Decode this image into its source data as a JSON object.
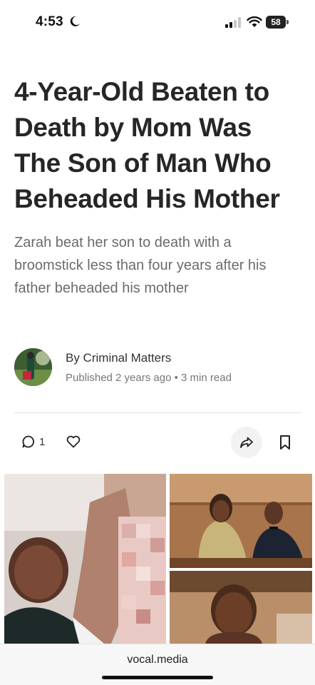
{
  "status_bar": {
    "time": "4:53",
    "battery": "58",
    "icons": [
      "moon-icon",
      "signal-icon",
      "wifi-icon",
      "battery-icon"
    ]
  },
  "article": {
    "headline": "4-Year-Old Beaten to Death by Mom Was The Son of Man Who Beheaded His Mother",
    "subtitle": "Zarah beat her son to death with a broomstick less than four years after his father beheaded his mother"
  },
  "byline": {
    "author": "By Criminal Matters",
    "published": "Published 2 years ago",
    "separator": "•",
    "read_time": "3 min read"
  },
  "actions": {
    "comment_count": "1",
    "icons": [
      "comment-icon",
      "heart-icon",
      "share-icon",
      "bookmark-icon"
    ]
  },
  "browser": {
    "url": "vocal.media"
  },
  "colors": {
    "headline": "#262626",
    "subtitle": "#6b6b6b",
    "meta": "#777777",
    "divider": "#e3e3e3"
  }
}
